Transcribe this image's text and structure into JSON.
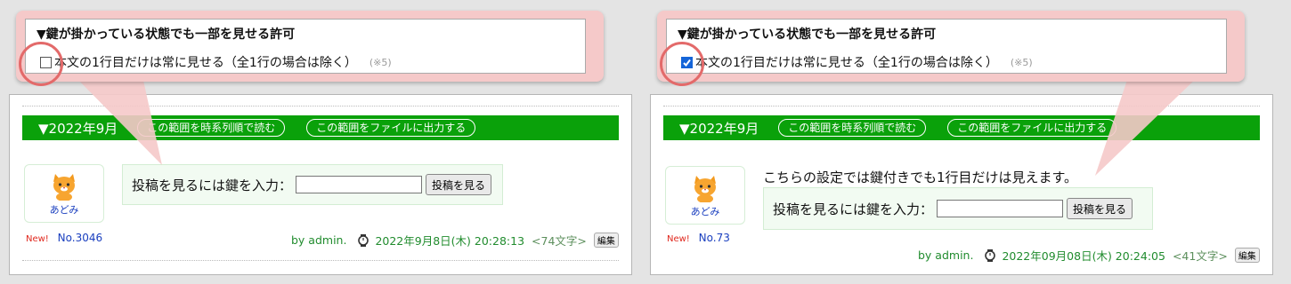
{
  "setting": {
    "title": "▼鍵が掛かっている状態でも一部を見せる許可",
    "option_label": "本文の1行目だけは常に見せる（全1行の場合は除く）",
    "option_ref": "(※5)"
  },
  "left": {
    "checkbox_checked": false,
    "post": {
      "month": "▼2022年9月",
      "btn_chrono": "この範囲を時系列順で読む",
      "btn_export": "この範囲をファイルに出力する",
      "user": "あどみ",
      "new_tag": "New!",
      "post_no": "No.3046",
      "key_prompt": "投稿を見るには鍵を入力：",
      "key_button": "投稿を見る",
      "by": "by admin.",
      "datetime": "2022年9月8日(木) 20:28:13",
      "char_count": "<74文字>",
      "edit": "編集"
    }
  },
  "right": {
    "checkbox_checked": true,
    "post": {
      "month": "▼2022年9月",
      "btn_chrono": "この範囲を時系列順で読む",
      "btn_export": "この範囲をファイルに出力する",
      "first_line": "こちらの設定では鍵付きでも1行目だけは見えます。",
      "user": "あどみ",
      "new_tag": "New!",
      "post_no": "No.73",
      "key_prompt": "投稿を見るには鍵を入力：",
      "key_button": "投稿を見る",
      "by": "by admin.",
      "datetime": "2022年09月08日(木) 20:24:05",
      "char_count": "<41文字>",
      "edit": "編集"
    }
  },
  "colors": {
    "green_bar": "#0aa10a",
    "highlight": "#e36a6a",
    "callout": "#f5c9c9",
    "checkbox_checked": "#1565d8"
  }
}
